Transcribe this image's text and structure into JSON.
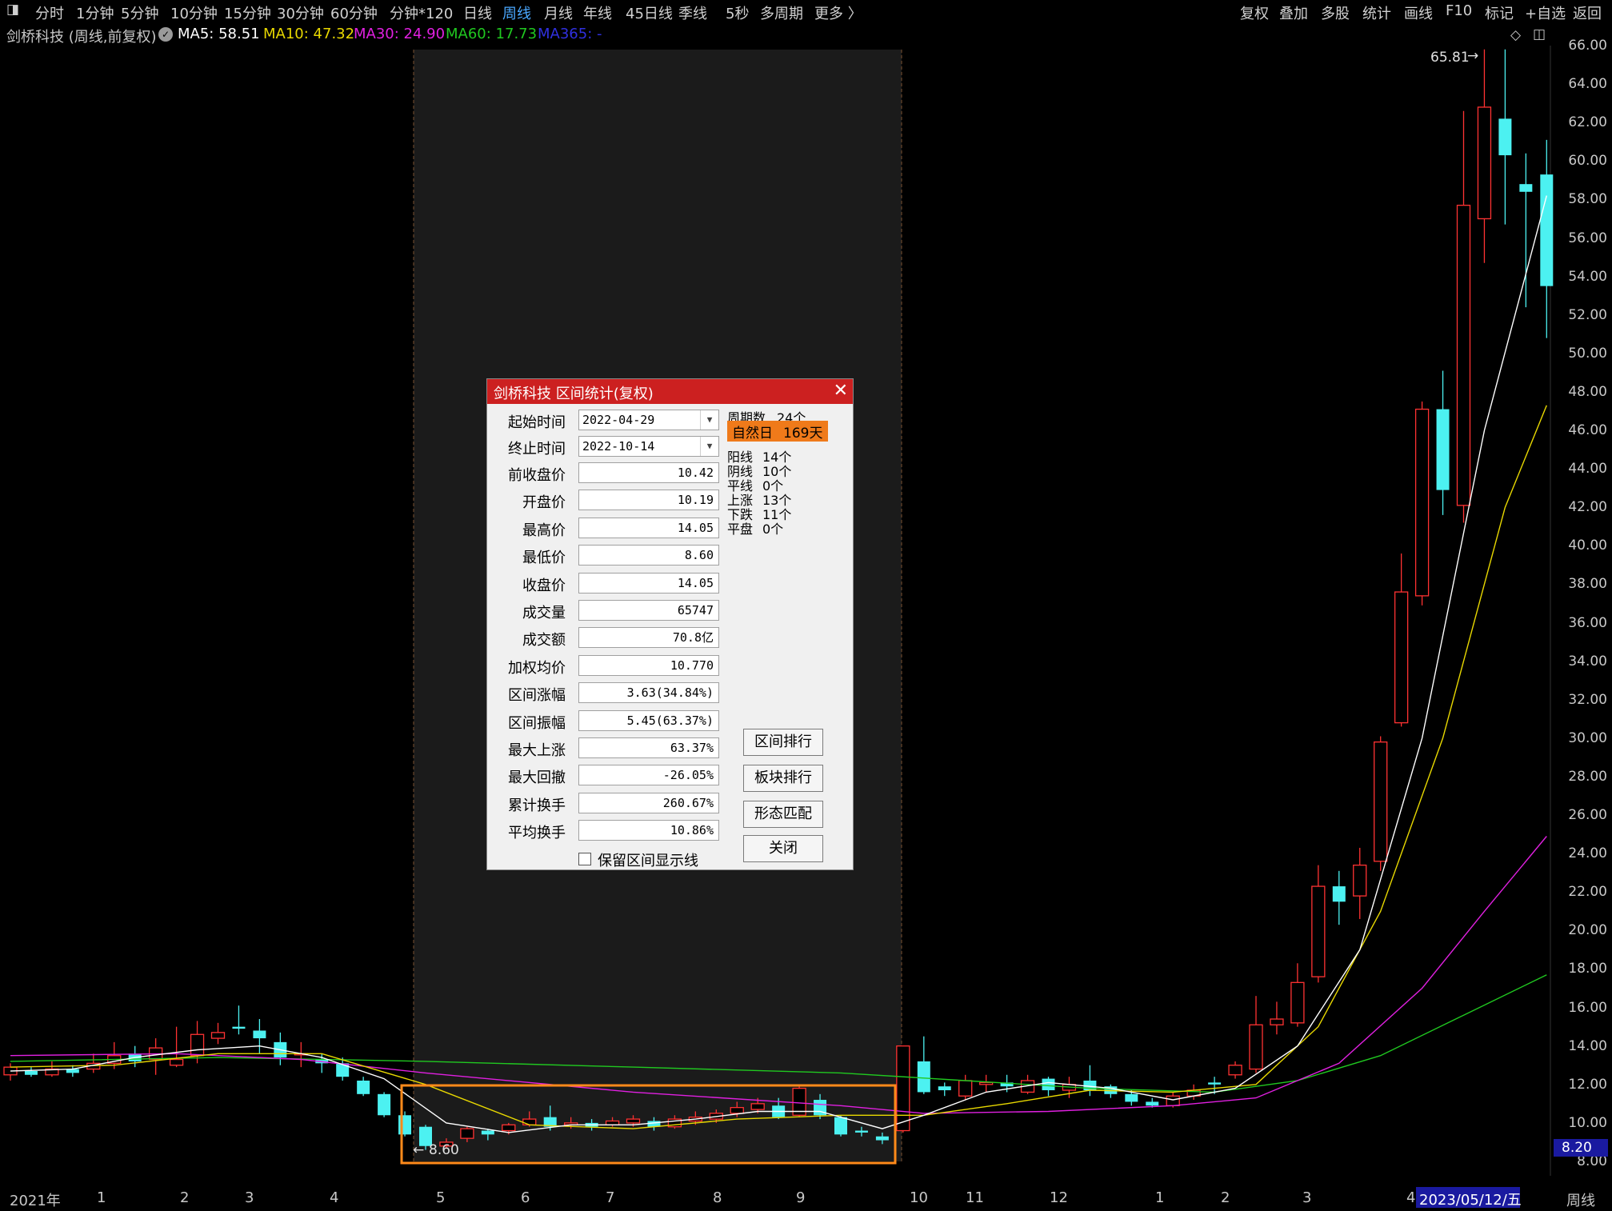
{
  "toolbar": {
    "left": [
      "分时",
      "1分钟",
      "5分钟",
      "10分钟",
      "15分钟",
      "30分钟",
      "60分钟",
      "分钟*120",
      "日线",
      "周线",
      "月线",
      "年线",
      "45日线",
      "季线",
      "5秒",
      "多周期",
      "更多 〉"
    ],
    "active": "周线",
    "right": [
      "复权",
      "叠加",
      "多股",
      "统计",
      "画线",
      "F10",
      "标记",
      "+自选",
      "返回"
    ]
  },
  "ma_header": {
    "title": "剑桥科技 (周线,前复权)",
    "items": [
      {
        "label": "MA5: 58.51",
        "color": "#ffffff"
      },
      {
        "label": "MA10: 47.32",
        "color": "#e8d800"
      },
      {
        "label": "MA30: 24.90",
        "color": "#e020e0"
      },
      {
        "label": "MA60: 17.73",
        "color": "#20c820"
      },
      {
        "label": "MA365: -",
        "color": "#3030e0"
      }
    ]
  },
  "axis": {
    "y_ticks": [
      "66.00",
      "64.00",
      "62.00",
      "60.00",
      "58.00",
      "56.00",
      "54.00",
      "52.00",
      "50.00",
      "48.00",
      "46.00",
      "44.00",
      "42.00",
      "40.00",
      "38.00",
      "36.00",
      "34.00",
      "32.00",
      "30.00",
      "28.00",
      "26.00",
      "24.00",
      "22.00",
      "20.00",
      "18.00",
      "16.00",
      "14.00",
      "12.00",
      "10.00",
      "8.00"
    ],
    "current_price": "8.20",
    "x_labels": [
      "2021年",
      "1",
      "2",
      "3",
      "4",
      "5",
      "6",
      "7",
      "8",
      "9",
      "10",
      "11",
      "12",
      "1",
      "2",
      "3",
      "4"
    ],
    "date_badge": "2023/05/12/五",
    "period": "周线"
  },
  "annotations": {
    "max_price": "65.81",
    "min_price": "8.60"
  },
  "chart_data": {
    "type": "candlestick",
    "ylim": [
      8,
      66
    ],
    "ma_colors": {
      "ma5": "#ffffff",
      "ma10": "#e8d800",
      "ma30": "#e020e0",
      "ma60": "#20c820"
    },
    "candles": [
      [
        12.5,
        12.9,
        13.1,
        12.2
      ],
      [
        12.7,
        12.5,
        12.9,
        12.4
      ],
      [
        12.5,
        12.8,
        13.2,
        12.4
      ],
      [
        12.8,
        12.6,
        13.0,
        12.4
      ],
      [
        12.8,
        13.1,
        13.6,
        12.6
      ],
      [
        13.1,
        13.5,
        14.2,
        12.8
      ],
      [
        13.6,
        13.2,
        14.0,
        12.9
      ],
      [
        13.3,
        13.9,
        14.4,
        12.5
      ],
      [
        13.0,
        13.3,
        15.0,
        12.9
      ],
      [
        13.5,
        14.6,
        15.3,
        13.1
      ],
      [
        14.4,
        14.7,
        15.2,
        14.1
      ],
      [
        15.0,
        14.9,
        16.1,
        14.6
      ],
      [
        14.8,
        14.4,
        15.4,
        13.6
      ],
      [
        14.2,
        13.4,
        14.7,
        13.0
      ],
      [
        13.6,
        13.6,
        14.2,
        12.9
      ],
      [
        13.3,
        13.1,
        13.6,
        12.6
      ],
      [
        13.1,
        12.4,
        13.4,
        12.2
      ],
      [
        12.2,
        11.5,
        12.4,
        11.4
      ],
      [
        11.5,
        10.4,
        11.6,
        10.3
      ],
      [
        10.4,
        9.4,
        10.6,
        9.3
      ],
      [
        9.8,
        8.8,
        9.9,
        8.6
      ],
      [
        8.8,
        9.0,
        9.2,
        8.7
      ],
      [
        9.2,
        9.7,
        9.8,
        9.0
      ],
      [
        9.6,
        9.4,
        9.7,
        9.1
      ],
      [
        9.6,
        9.9,
        10.0,
        9.4
      ],
      [
        9.9,
        10.2,
        10.6,
        9.8
      ],
      [
        10.3,
        9.8,
        10.9,
        9.6
      ],
      [
        9.9,
        10.0,
        10.3,
        9.7
      ],
      [
        10.0,
        9.8,
        10.2,
        9.6
      ],
      [
        9.9,
        10.1,
        10.3,
        9.8
      ],
      [
        10.0,
        10.2,
        10.4,
        9.8
      ],
      [
        10.1,
        9.8,
        10.3,
        9.6
      ],
      [
        9.8,
        10.2,
        10.4,
        9.7
      ],
      [
        10.1,
        10.3,
        10.6,
        9.9
      ],
      [
        10.2,
        10.5,
        10.7,
        10.0
      ],
      [
        10.5,
        10.8,
        11.1,
        10.3
      ],
      [
        10.7,
        11.0,
        11.3,
        10.5
      ],
      [
        10.9,
        10.3,
        11.3,
        10.2
      ],
      [
        10.4,
        11.8,
        11.9,
        10.3
      ],
      [
        11.2,
        10.4,
        11.5,
        10.2
      ],
      [
        10.3,
        9.4,
        10.4,
        9.3
      ],
      [
        9.6,
        9.5,
        9.8,
        9.3
      ],
      [
        9.3,
        9.1,
        9.5,
        8.9
      ],
      [
        9.6,
        14.0,
        14.0,
        9.5
      ],
      [
        13.2,
        11.6,
        14.5,
        11.5
      ],
      [
        11.9,
        11.7,
        12.1,
        11.4
      ],
      [
        11.4,
        12.2,
        12.5,
        11.2
      ],
      [
        12.0,
        12.1,
        12.5,
        11.6
      ],
      [
        12.1,
        11.9,
        12.5,
        11.6
      ],
      [
        11.6,
        12.2,
        12.5,
        11.5
      ],
      [
        12.3,
        11.7,
        12.4,
        11.4
      ],
      [
        11.7,
        12.0,
        12.4,
        11.3
      ],
      [
        12.2,
        11.7,
        13.0,
        11.4
      ],
      [
        11.9,
        11.5,
        12.0,
        11.3
      ],
      [
        11.5,
        11.1,
        11.7,
        10.9
      ],
      [
        11.1,
        10.9,
        11.3,
        10.8
      ],
      [
        10.9,
        11.4,
        11.6,
        10.8
      ],
      [
        11.4,
        11.7,
        12.0,
        11.2
      ],
      [
        12.1,
        12.0,
        12.4,
        11.5
      ],
      [
        12.5,
        13.0,
        13.2,
        12.3
      ],
      [
        12.8,
        15.1,
        16.6,
        12.6
      ],
      [
        15.1,
        15.4,
        16.3,
        14.6
      ],
      [
        15.2,
        17.3,
        18.3,
        15.0
      ],
      [
        17.6,
        22.3,
        23.4,
        17.3
      ],
      [
        22.3,
        21.5,
        23.1,
        20.3
      ],
      [
        21.8,
        23.4,
        24.3,
        20.6
      ],
      [
        23.6,
        29.8,
        30.1,
        23.1
      ],
      [
        30.8,
        37.6,
        39.6,
        30.6
      ],
      [
        37.4,
        47.1,
        47.5,
        36.9
      ],
      [
        47.1,
        42.9,
        49.1,
        41.6
      ],
      [
        42.1,
        57.7,
        62.6,
        41.2
      ],
      [
        57.0,
        62.8,
        65.8,
        54.7
      ],
      [
        62.2,
        60.3,
        65.8,
        56.7
      ],
      [
        58.8,
        58.4,
        60.4,
        52.4
      ],
      [
        59.3,
        53.5,
        61.1,
        50.8
      ]
    ],
    "ma5": [
      [
        0,
        12.7
      ],
      [
        3,
        12.8
      ],
      [
        6,
        13.4
      ],
      [
        9,
        13.8
      ],
      [
        12,
        14.0
      ],
      [
        15,
        13.4
      ],
      [
        18,
        12.3
      ],
      [
        21,
        10.0
      ],
      [
        24,
        9.5
      ],
      [
        27,
        9.9
      ],
      [
        30,
        9.9
      ],
      [
        33,
        10.2
      ],
      [
        36,
        10.6
      ],
      [
        39,
        10.6
      ],
      [
        42,
        9.7
      ],
      [
        44,
        10.4
      ],
      [
        47,
        11.6
      ],
      [
        50,
        12.1
      ],
      [
        53,
        11.8
      ],
      [
        56,
        11.2
      ],
      [
        59,
        11.8
      ],
      [
        62,
        14.0
      ],
      [
        65,
        19.0
      ],
      [
        68,
        30.0
      ],
      [
        71,
        46.0
      ],
      [
        74,
        58.2
      ]
    ],
    "ma10": [
      [
        0,
        12.9
      ],
      [
        5,
        13.0
      ],
      [
        10,
        13.6
      ],
      [
        15,
        13.6
      ],
      [
        20,
        12.0
      ],
      [
        25,
        9.9
      ],
      [
        30,
        9.7
      ],
      [
        35,
        10.2
      ],
      [
        40,
        10.4
      ],
      [
        44,
        10.4
      ],
      [
        48,
        11.0
      ],
      [
        52,
        11.7
      ],
      [
        56,
        11.6
      ],
      [
        60,
        12.0
      ],
      [
        63,
        15.0
      ],
      [
        66,
        21.0
      ],
      [
        69,
        30.0
      ],
      [
        72,
        42.0
      ],
      [
        74,
        47.3
      ]
    ],
    "ma30": [
      [
        0,
        13.5
      ],
      [
        8,
        13.6
      ],
      [
        14,
        13.3
      ],
      [
        20,
        12.6
      ],
      [
        30,
        11.6
      ],
      [
        40,
        10.9
      ],
      [
        44,
        10.5
      ],
      [
        50,
        10.6
      ],
      [
        56,
        10.9
      ],
      [
        60,
        11.3
      ],
      [
        64,
        13.1
      ],
      [
        68,
        17.0
      ],
      [
        71,
        21.0
      ],
      [
        74,
        24.9
      ]
    ],
    "ma60": [
      [
        0,
        13.2
      ],
      [
        10,
        13.4
      ],
      [
        20,
        13.2
      ],
      [
        30,
        12.9
      ],
      [
        40,
        12.6
      ],
      [
        46,
        12.2
      ],
      [
        52,
        11.8
      ],
      [
        58,
        11.6
      ],
      [
        62,
        12.2
      ],
      [
        66,
        13.5
      ],
      [
        70,
        15.6
      ],
      [
        74,
        17.7
      ]
    ]
  },
  "dialog": {
    "title": "剑桥科技 区间统计(复权)",
    "start_label": "起始时间",
    "start_value": "2022-04-29",
    "end_label": "终止时间",
    "end_value": "2022-10-14",
    "rows": [
      {
        "label": "前收盘价",
        "value": "10.42"
      },
      {
        "label": "开盘价",
        "value": "10.19"
      },
      {
        "label": "最高价",
        "value": "14.05"
      },
      {
        "label": "最低价",
        "value": "8.60"
      },
      {
        "label": "收盘价",
        "value": "14.05"
      },
      {
        "label": "成交量",
        "value": "65747"
      },
      {
        "label": "成交额",
        "value": "70.8亿"
      },
      {
        "label": "加权均价",
        "value": "10.770"
      },
      {
        "label": "区间涨幅",
        "value": "3.63(34.84%)"
      },
      {
        "label": "区间振幅",
        "value": "5.45(63.37%)"
      },
      {
        "label": "最大上涨",
        "value": "63.37%"
      },
      {
        "label": "最大回撤",
        "value": "-26.05%"
      },
      {
        "label": "累计换手",
        "value": "260.67%"
      },
      {
        "label": "平均换手",
        "value": "10.86%"
      }
    ],
    "periods_label": "周期数",
    "periods_value": "24个",
    "natural_days_label": "自然日",
    "natural_days_value": "169天",
    "stats": [
      {
        "label": "阳线",
        "value": "14个"
      },
      {
        "label": "阴线",
        "value": "10个"
      },
      {
        "label": "平线",
        "value": "0个"
      },
      {
        "label": "上涨",
        "value": "13个"
      },
      {
        "label": "下跌",
        "value": "11个"
      },
      {
        "label": "平盘",
        "value": "0个"
      }
    ],
    "buttons": [
      "区间排行",
      "板块排行",
      "形态匹配",
      "关闭"
    ],
    "checkbox_label": "保留区间显示线",
    "close_glyph": "✕"
  }
}
